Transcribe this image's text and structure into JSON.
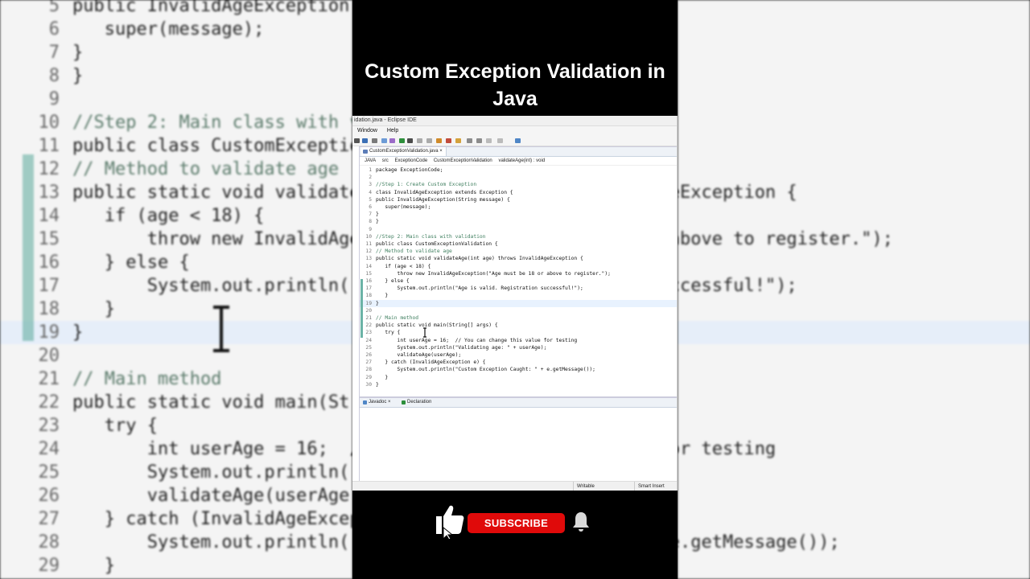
{
  "overlay": {
    "title": "Custom Exception Validation in Java",
    "subscribe_label": "SUBSCRIBE"
  },
  "window": {
    "title": "idation.java - Eclipse IDE",
    "menu": [
      "Window",
      "Help"
    ]
  },
  "editor": {
    "tab_label": "CustomExceptionValidation.java",
    "breadcrumb": [
      "JAVA",
      "src",
      "ExceptionCode",
      "CustomExceptionValidation",
      "validateAge(int) : void"
    ],
    "lines": [
      {
        "n": "1",
        "t": "package ExceptionCode;"
      },
      {
        "n": "2",
        "t": ""
      },
      {
        "n": "3",
        "t": "//Step 1: Create Custom Exception"
      },
      {
        "n": "4",
        "t": "class InvalidAgeException extends Exception {"
      },
      {
        "n": "5",
        "t": "public InvalidAgeException(String message) {"
      },
      {
        "n": "6",
        "t": "   super(message);"
      },
      {
        "n": "7",
        "t": "}"
      },
      {
        "n": "8",
        "t": "}"
      },
      {
        "n": "9",
        "t": ""
      },
      {
        "n": "10",
        "t": "//Step 2: Main class with validation"
      },
      {
        "n": "11",
        "t": "public class CustomExceptionValidation {"
      },
      {
        "n": "12",
        "t": "// Method to validate age"
      },
      {
        "n": "13",
        "t": "public static void validateAge(int age) throws InvalidAgeException {"
      },
      {
        "n": "14",
        "t": "   if (age < 18) {"
      },
      {
        "n": "15",
        "t": "       throw new InvalidAgeException(\"Age must be 18 or above to register.\");"
      },
      {
        "n": "16",
        "t": "   } else {"
      },
      {
        "n": "17",
        "t": "       System.out.println(\"Age is valid. Registration successful!\");"
      },
      {
        "n": "18",
        "t": "   }"
      },
      {
        "n": "19",
        "t": "}"
      },
      {
        "n": "20",
        "t": ""
      },
      {
        "n": "21",
        "t": "// Main method"
      },
      {
        "n": "22",
        "t": "public static void main(String[] args) {"
      },
      {
        "n": "23",
        "t": "   try {"
      },
      {
        "n": "24",
        "t": "       int userAge = 16;  // You can change this value for testing"
      },
      {
        "n": "25",
        "t": "       System.out.println(\"Validating age: \" + userAge);"
      },
      {
        "n": "26",
        "t": "       validateAge(userAge);"
      },
      {
        "n": "27",
        "t": "   } catch (InvalidAgeException e) {"
      },
      {
        "n": "28",
        "t": "       System.out.println(\"Custom Exception Caught: \" + e.getMessage());"
      },
      {
        "n": "29",
        "t": "   }"
      },
      {
        "n": "30",
        "t": "}"
      }
    ]
  },
  "views": {
    "tabs": [
      "Javadoc",
      "Declaration"
    ]
  },
  "statusbar": {
    "writable": "Writable",
    "insert_mode": "Smart Insert"
  },
  "background_zoom": {
    "lines": [
      {
        "n": "5",
        "t": "public InvalidAgeException(String message) {"
      },
      {
        "n": "6",
        "t": "   super(message);"
      },
      {
        "n": "7",
        "t": "}"
      },
      {
        "n": "8",
        "t": "}"
      },
      {
        "n": "9",
        "t": ""
      },
      {
        "n": "10",
        "t": "//Step 2: Main class with validation"
      },
      {
        "n": "11",
        "t": "public class CustomExceptionValidation {"
      },
      {
        "n": "12",
        "t": "// Method to validate age"
      },
      {
        "n": "13",
        "t": "public static void validateAge(int age) throws InvalidAgeException {"
      },
      {
        "n": "14",
        "t": "   if (age < 18) {"
      },
      {
        "n": "15",
        "t": "       throw new InvalidAgeException(\"Age must be 18 or above to register.\");"
      },
      {
        "n": "16",
        "t": "   } else {"
      },
      {
        "n": "17",
        "t": "       System.out.println(\"Age is valid. Registration successful!\");"
      },
      {
        "n": "18",
        "t": "   }"
      },
      {
        "n": "19",
        "t": "}"
      },
      {
        "n": "20",
        "t": ""
      },
      {
        "n": "21",
        "t": "// Main method"
      },
      {
        "n": "22",
        "t": "public static void main(String[] args) {"
      },
      {
        "n": "23",
        "t": "   try {"
      },
      {
        "n": "24",
        "t": "       int userAge = 16;  // You can change this value for testing"
      },
      {
        "n": "25",
        "t": "       System.out.println(\"Validating age: \" + userAge);"
      },
      {
        "n": "26",
        "t": "       validateAge(userAge);"
      },
      {
        "n": "27",
        "t": "   } catch (InvalidAgeException e) {"
      },
      {
        "n": "28",
        "t": "       System.out.println(\"Custom Exception Caught: \" + e.getMessage());"
      },
      {
        "n": "29",
        "t": "   }"
      }
    ]
  },
  "colors": {
    "keyword": "#7f0055",
    "comment": "#3f7f5f",
    "string": "#2a00ff",
    "subscribe_red": "#e00a0a"
  }
}
